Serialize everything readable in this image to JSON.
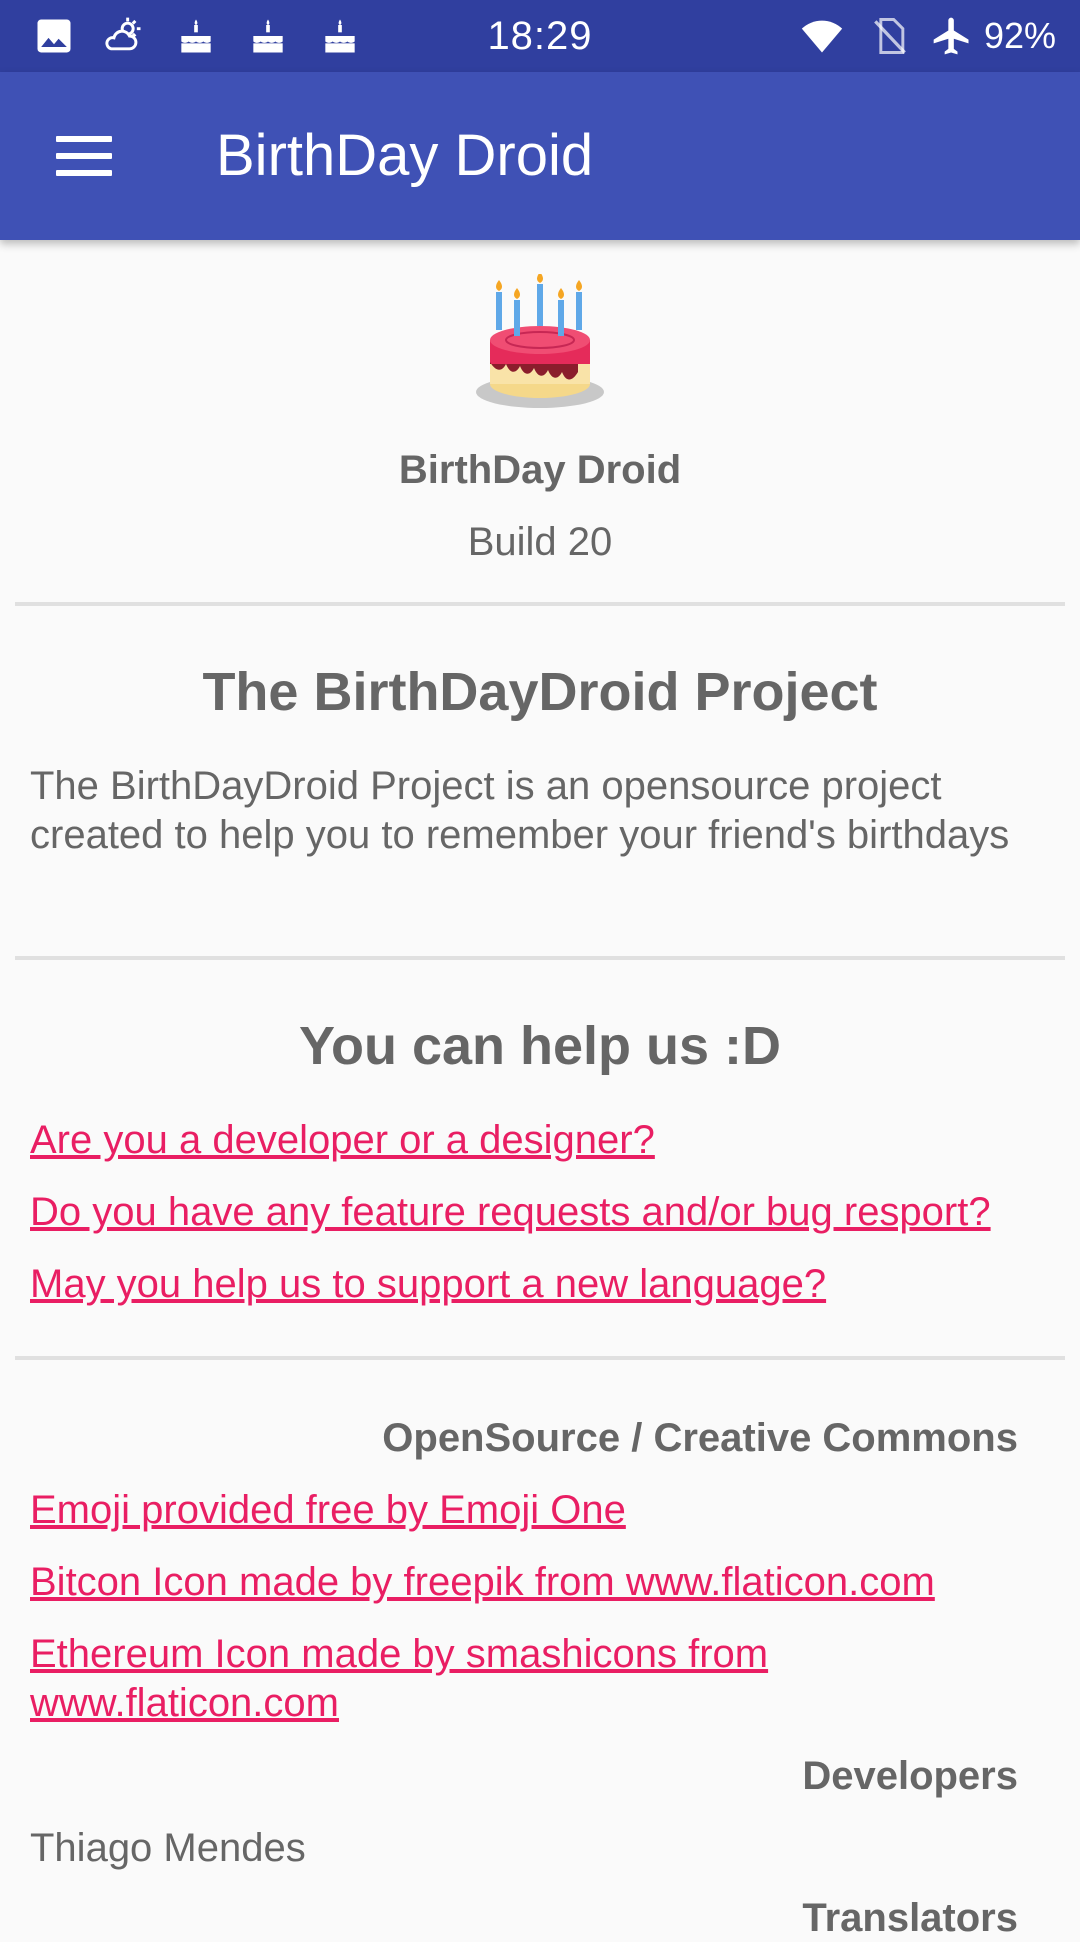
{
  "status_bar": {
    "time": "18:29",
    "battery": "92%",
    "icons": [
      "image-icon",
      "weather-icon",
      "cake-icon",
      "cake-icon",
      "cake-icon",
      "wifi-icon",
      "no-sim-icon",
      "airplane-icon"
    ]
  },
  "app_bar": {
    "title": "BirthDay Droid",
    "menu_icon": "hamburger-menu-icon"
  },
  "header": {
    "logo_icon": "birthday-cake-icon",
    "app_name": "BirthDay Droid",
    "build": "Build 20"
  },
  "project": {
    "title": "The BirthDayDroid Project",
    "description": "The BirthDayDroid Project is an opensource project created to help you to remember your friend's birthdays"
  },
  "help": {
    "title": "You can help us :D",
    "links": [
      "Are you a developer or a designer?",
      "Do you have any feature requests and/or bug resport?",
      "May you help us to support a new language?"
    ]
  },
  "credits": {
    "title": "OpenSource / Creative Commons",
    "links": [
      "Emoji provided free by Emoji One",
      "Bitcon Icon made by freepik from www.flaticon.com",
      "Ethereum Icon made by smashicons from www.flaticon.com"
    ]
  },
  "developers": {
    "title": "Developers",
    "names": [
      "Thiago Mendes"
    ]
  },
  "translators": {
    "title": "Translators"
  },
  "colors": {
    "status_bar": "#303f9f",
    "app_bar": "#3f51b5",
    "link": "#e91e63",
    "text": "#666666",
    "background": "#fafafa"
  }
}
